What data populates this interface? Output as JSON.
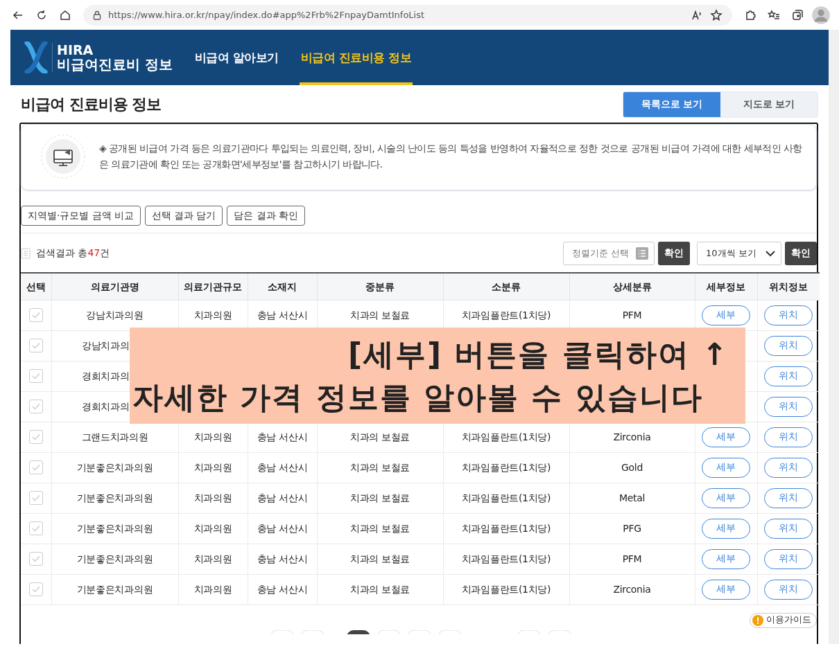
{
  "browser": {
    "url": "https://www.hira.or.kr/npay/index.do#app%2Frb%2FnpayDamtInfoList"
  },
  "header": {
    "logo_top": "HIRA",
    "logo_bottom": "비급여진료비 정보"
  },
  "nav": [
    {
      "label": "비급여 알아보기",
      "selected": false
    },
    {
      "label": "비급여 진료비용 정보",
      "selected": true
    }
  ],
  "page_title": "비급여 진료비용 정보",
  "view_toggle": [
    {
      "label": "목록으로 보기",
      "selected": true
    },
    {
      "label": "지도로 보기",
      "selected": false
    }
  ],
  "notice": "◈ 공개된 비급여 가격 등은 의료기관마다 투입되는 의료인력, 장비, 시술의 난이도 등의 특성을 반영하여 자율적으로 정한 것으로 공개된 비급여 가격에 대한 세부적인 사항은 의료기관에 확인 또는 공개화면'세부정보'를 참고하시기 바랍니다.",
  "actions": [
    "지역별·규모별 금액 비교",
    "선택 결과 담기",
    "담은 결과 확인"
  ],
  "results": {
    "label": "검색결과 총",
    "count": "47",
    "unit": "건"
  },
  "sort": {
    "placeholder": "정렬기준 선택",
    "confirm": "확인"
  },
  "page_size": {
    "value": "10개씩 보기",
    "confirm": "확인"
  },
  "table": {
    "columns": [
      "선택",
      "의료기관명",
      "의료기관규모",
      "소재지",
      "중분류",
      "소분류",
      "상세분류",
      "세부정보",
      "위치정보"
    ],
    "rows": [
      {
        "checked": false,
        "name": "강남치과의원",
        "size": "치과의원",
        "location": "충남 서산시",
        "mid": "치과의 보철료",
        "sub": "치과임플란트(1치당)",
        "detail": "PFM",
        "detail_button": "세부",
        "location_button": "위치"
      },
      {
        "checked": false,
        "name": "강남치과의",
        "location_button": "위치"
      },
      {
        "checked": false,
        "name": "경희치과의",
        "location_button": "위치"
      },
      {
        "checked": false,
        "name": "경희치과의",
        "location_button": "위치"
      },
      {
        "checked": false,
        "name": "그랜드치과의원",
        "size": "치과의원",
        "location": "충남 서산시",
        "mid": "치과의 보철료",
        "sub": "치과임플란트(1치당)",
        "detail": "Zirconia",
        "detail_button": "세부",
        "location_button": "위치"
      },
      {
        "checked": false,
        "name": "기분좋은치과의원",
        "size": "치과의원",
        "location": "충남 서산시",
        "mid": "치과의 보철료",
        "sub": "치과임플란트(1치당)",
        "detail": "Gold",
        "detail_button": "세부",
        "location_button": "위치"
      },
      {
        "checked": false,
        "name": "기분좋은치과의원",
        "size": "치과의원",
        "location": "충남 서산시",
        "mid": "치과의 보철료",
        "sub": "치과임플란트(1치당)",
        "detail": "Metal",
        "detail_button": "세부",
        "location_button": "위치"
      },
      {
        "checked": false,
        "name": "기분좋은치과의원",
        "size": "치과의원",
        "location": "충남 서산시",
        "mid": "치과의 보철료",
        "sub": "치과임플란트(1치당)",
        "detail": "PFG",
        "detail_button": "세부",
        "location_button": "위치"
      },
      {
        "checked": false,
        "name": "기분좋은치과의원",
        "size": "치과의원",
        "location": "충남 서산시",
        "mid": "치과의 보철료",
        "sub": "치과임플란트(1치당)",
        "detail": "PFM",
        "detail_button": "세부",
        "location_button": "위치"
      },
      {
        "checked": false,
        "name": "기분좋은치과의원",
        "size": "치과의원",
        "location": "충남 서산시",
        "mid": "치과의 보철료",
        "sub": "치과임플란트(1치당)",
        "detail": "Zirconia",
        "detail_button": "세부",
        "location_button": "위치"
      }
    ]
  },
  "guide_button": "이용가이드",
  "overlay": {
    "line1": "[세부] 버튼을 클릭하여 ↑",
    "line2": "자세한 가격 정보를 알아볼 수 있습니다"
  }
}
